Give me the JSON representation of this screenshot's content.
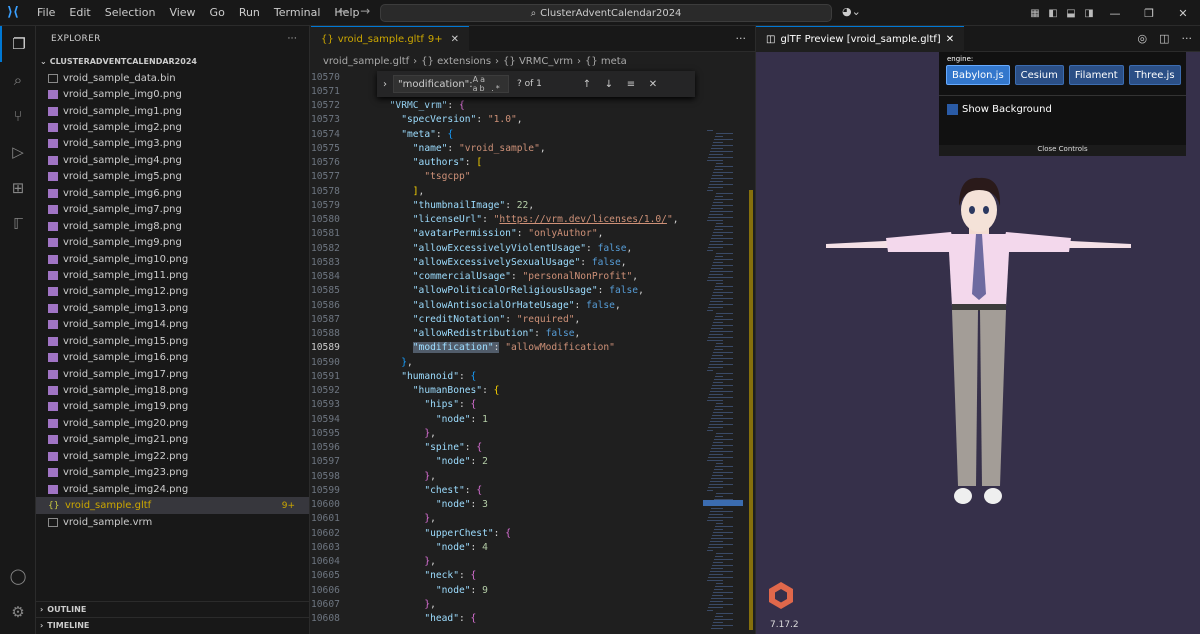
{
  "titlebar": {
    "menu": [
      "File",
      "Edit",
      "Selection",
      "View",
      "Go",
      "Run",
      "Terminal",
      "Help"
    ],
    "search": "ClusterAdventCalendar2024"
  },
  "sidebar": {
    "title": "EXPLORER",
    "root": "CLUSTERADVENTCALENDAR2024",
    "files": [
      {
        "name": "vroid_sample_data.bin",
        "type": "bin"
      },
      {
        "name": "vroid_sample_img0.png",
        "type": "png"
      },
      {
        "name": "vroid_sample_img1.png",
        "type": "png"
      },
      {
        "name": "vroid_sample_img2.png",
        "type": "png"
      },
      {
        "name": "vroid_sample_img3.png",
        "type": "png"
      },
      {
        "name": "vroid_sample_img4.png",
        "type": "png"
      },
      {
        "name": "vroid_sample_img5.png",
        "type": "png"
      },
      {
        "name": "vroid_sample_img6.png",
        "type": "png"
      },
      {
        "name": "vroid_sample_img7.png",
        "type": "png"
      },
      {
        "name": "vroid_sample_img8.png",
        "type": "png"
      },
      {
        "name": "vroid_sample_img9.png",
        "type": "png"
      },
      {
        "name": "vroid_sample_img10.png",
        "type": "png"
      },
      {
        "name": "vroid_sample_img11.png",
        "type": "png"
      },
      {
        "name": "vroid_sample_img12.png",
        "type": "png"
      },
      {
        "name": "vroid_sample_img13.png",
        "type": "png"
      },
      {
        "name": "vroid_sample_img14.png",
        "type": "png"
      },
      {
        "name": "vroid_sample_img15.png",
        "type": "png"
      },
      {
        "name": "vroid_sample_img16.png",
        "type": "png"
      },
      {
        "name": "vroid_sample_img17.png",
        "type": "png"
      },
      {
        "name": "vroid_sample_img18.png",
        "type": "png"
      },
      {
        "name": "vroid_sample_img19.png",
        "type": "png"
      },
      {
        "name": "vroid_sample_img20.png",
        "type": "png"
      },
      {
        "name": "vroid_sample_img21.png",
        "type": "png"
      },
      {
        "name": "vroid_sample_img22.png",
        "type": "png"
      },
      {
        "name": "vroid_sample_img23.png",
        "type": "png"
      },
      {
        "name": "vroid_sample_img24.png",
        "type": "png"
      },
      {
        "name": "vroid_sample.gltf",
        "type": "json",
        "badge": "9+",
        "selected": true
      },
      {
        "name": "vroid_sample.vrm",
        "type": "vrm"
      }
    ],
    "outline": "OUTLINE",
    "timeline": "TIMELINE"
  },
  "editor": {
    "tab_label": "vroid_sample.gltf",
    "tab_badge": "9+",
    "breadcrumbs": [
      "vroid_sample.gltf",
      "{} extensions",
      "{} VRMC_vrm",
      "{} meta"
    ],
    "find": {
      "query": "\"modification\":",
      "count": "? of 1",
      "options": "Aa ab .*"
    },
    "lines": [
      {
        "n": "10570",
        "t": [
          [
            "    ",
            "p"
          ],
          [
            "\"extensions\"",
            "k"
          ],
          [
            ": ",
            "p"
          ],
          [
            "{",
            "br1"
          ]
        ]
      },
      {
        "n": "10571",
        "t": [
          [
            "    ",
            "p"
          ],
          [
            "\"extensions\"",
            "k"
          ],
          [
            ": ",
            "p"
          ],
          [
            "{",
            "br1"
          ]
        ]
      },
      {
        "n": "10572",
        "t": [
          [
            "      ",
            "p"
          ],
          [
            "\"VRMC_vrm\"",
            "k"
          ],
          [
            ": ",
            "p"
          ],
          [
            "{",
            "br2"
          ]
        ]
      },
      {
        "n": "10573",
        "t": [
          [
            "        ",
            "p"
          ],
          [
            "\"specVersion\"",
            "k"
          ],
          [
            ": ",
            "p"
          ],
          [
            "\"1.0\"",
            "s"
          ],
          [
            ",",
            "p"
          ]
        ]
      },
      {
        "n": "10574",
        "t": [
          [
            "        ",
            "p"
          ],
          [
            "\"meta\"",
            "k"
          ],
          [
            ": ",
            "p"
          ],
          [
            "{",
            "br3"
          ]
        ]
      },
      {
        "n": "10575",
        "t": [
          [
            "          ",
            "p"
          ],
          [
            "\"name\"",
            "k"
          ],
          [
            ": ",
            "p"
          ],
          [
            "\"vroid_sample\"",
            "s"
          ],
          [
            ",",
            "p"
          ]
        ]
      },
      {
        "n": "10576",
        "t": [
          [
            "          ",
            "p"
          ],
          [
            "\"authors\"",
            "k"
          ],
          [
            ": ",
            "p"
          ],
          [
            "[",
            "br1"
          ]
        ]
      },
      {
        "n": "10577",
        "t": [
          [
            "            ",
            "p"
          ],
          [
            "\"tsgcpp\"",
            "s"
          ]
        ]
      },
      {
        "n": "10578",
        "t": [
          [
            "          ",
            "p"
          ],
          [
            "]",
            "br1"
          ],
          [
            ",",
            "p"
          ]
        ]
      },
      {
        "n": "10579",
        "t": [
          [
            "          ",
            "p"
          ],
          [
            "\"thumbnailImage\"",
            "k"
          ],
          [
            ": ",
            "p"
          ],
          [
            "22",
            "n"
          ],
          [
            ",",
            "p"
          ]
        ]
      },
      {
        "n": "10580",
        "t": [
          [
            "          ",
            "p"
          ],
          [
            "\"licenseUrl\"",
            "k"
          ],
          [
            ": ",
            "p"
          ],
          [
            "\"",
            "s"
          ],
          [
            "https://vrm.dev/licenses/1.0/",
            "s u"
          ],
          [
            "\"",
            "s"
          ],
          [
            ",",
            "p"
          ]
        ]
      },
      {
        "n": "10581",
        "t": [
          [
            "          ",
            "p"
          ],
          [
            "\"avatarPermission\"",
            "k"
          ],
          [
            ": ",
            "p"
          ],
          [
            "\"onlyAuthor\"",
            "s"
          ],
          [
            ",",
            "p"
          ]
        ]
      },
      {
        "n": "10582",
        "t": [
          [
            "          ",
            "p"
          ],
          [
            "\"allowExcessivelyViolentUsage\"",
            "k"
          ],
          [
            ": ",
            "p"
          ],
          [
            "false",
            "b"
          ],
          [
            ",",
            "p"
          ]
        ]
      },
      {
        "n": "10583",
        "t": [
          [
            "          ",
            "p"
          ],
          [
            "\"allowExcessivelySexualUsage\"",
            "k"
          ],
          [
            ": ",
            "p"
          ],
          [
            "false",
            "b"
          ],
          [
            ",",
            "p"
          ]
        ]
      },
      {
        "n": "10584",
        "t": [
          [
            "          ",
            "p"
          ],
          [
            "\"commercialUsage\"",
            "k"
          ],
          [
            ": ",
            "p"
          ],
          [
            "\"personalNonProfit\"",
            "s"
          ],
          [
            ",",
            "p"
          ]
        ]
      },
      {
        "n": "10585",
        "t": [
          [
            "          ",
            "p"
          ],
          [
            "\"allowPoliticalOrReligiousUsage\"",
            "k"
          ],
          [
            ": ",
            "p"
          ],
          [
            "false",
            "b"
          ],
          [
            ",",
            "p"
          ]
        ]
      },
      {
        "n": "10586",
        "t": [
          [
            "          ",
            "p"
          ],
          [
            "\"allowAntisocialOrHateUsage\"",
            "k"
          ],
          [
            ": ",
            "p"
          ],
          [
            "false",
            "b"
          ],
          [
            ",",
            "p"
          ]
        ]
      },
      {
        "n": "10587",
        "t": [
          [
            "          ",
            "p"
          ],
          [
            "\"creditNotation\"",
            "k"
          ],
          [
            ": ",
            "p"
          ],
          [
            "\"required\"",
            "s"
          ],
          [
            ",",
            "p"
          ]
        ]
      },
      {
        "n": "10588",
        "t": [
          [
            "          ",
            "p"
          ],
          [
            "\"allowRedistribution\"",
            "k"
          ],
          [
            ": ",
            "p"
          ],
          [
            "false",
            "b"
          ],
          [
            ",",
            "p"
          ]
        ]
      },
      {
        "n": "10589",
        "cur": true,
        "t": [
          [
            "          ",
            "p"
          ],
          [
            "\"modification\"",
            "k hl"
          ],
          [
            ":",
            "p hl"
          ],
          [
            " ",
            "p"
          ],
          [
            "\"allowModification\"",
            "s"
          ]
        ]
      },
      {
        "n": "10590",
        "t": [
          [
            "        ",
            "p"
          ],
          [
            "}",
            "br3"
          ],
          [
            ",",
            "p"
          ]
        ]
      },
      {
        "n": "10591",
        "t": [
          [
            "        ",
            "p"
          ],
          [
            "\"humanoid\"",
            "k"
          ],
          [
            ": ",
            "p"
          ],
          [
            "{",
            "br3"
          ]
        ]
      },
      {
        "n": "10592",
        "t": [
          [
            "          ",
            "p"
          ],
          [
            "\"humanBones\"",
            "k"
          ],
          [
            ": ",
            "p"
          ],
          [
            "{",
            "br1"
          ]
        ]
      },
      {
        "n": "10593",
        "t": [
          [
            "            ",
            "p"
          ],
          [
            "\"hips\"",
            "k"
          ],
          [
            ": ",
            "p"
          ],
          [
            "{",
            "br2"
          ]
        ]
      },
      {
        "n": "10594",
        "t": [
          [
            "              ",
            "p"
          ],
          [
            "\"node\"",
            "k"
          ],
          [
            ": ",
            "p"
          ],
          [
            "1",
            "n"
          ]
        ]
      },
      {
        "n": "10595",
        "t": [
          [
            "            ",
            "p"
          ],
          [
            "}",
            "br2"
          ],
          [
            ",",
            "p"
          ]
        ]
      },
      {
        "n": "10596",
        "t": [
          [
            "            ",
            "p"
          ],
          [
            "\"spine\"",
            "k"
          ],
          [
            ": ",
            "p"
          ],
          [
            "{",
            "br2"
          ]
        ]
      },
      {
        "n": "10597",
        "t": [
          [
            "              ",
            "p"
          ],
          [
            "\"node\"",
            "k"
          ],
          [
            ": ",
            "p"
          ],
          [
            "2",
            "n"
          ]
        ]
      },
      {
        "n": "10598",
        "t": [
          [
            "            ",
            "p"
          ],
          [
            "}",
            "br2"
          ],
          [
            ",",
            "p"
          ]
        ]
      },
      {
        "n": "10599",
        "t": [
          [
            "            ",
            "p"
          ],
          [
            "\"chest\"",
            "k"
          ],
          [
            ": ",
            "p"
          ],
          [
            "{",
            "br2"
          ]
        ]
      },
      {
        "n": "10600",
        "t": [
          [
            "              ",
            "p"
          ],
          [
            "\"node\"",
            "k"
          ],
          [
            ": ",
            "p"
          ],
          [
            "3",
            "n"
          ]
        ]
      },
      {
        "n": "10601",
        "t": [
          [
            "            ",
            "p"
          ],
          [
            "}",
            "br2"
          ],
          [
            ",",
            "p"
          ]
        ]
      },
      {
        "n": "10602",
        "t": [
          [
            "            ",
            "p"
          ],
          [
            "\"upperChest\"",
            "k"
          ],
          [
            ": ",
            "p"
          ],
          [
            "{",
            "br2"
          ]
        ]
      },
      {
        "n": "10603",
        "t": [
          [
            "              ",
            "p"
          ],
          [
            "\"node\"",
            "k"
          ],
          [
            ": ",
            "p"
          ],
          [
            "4",
            "n"
          ]
        ]
      },
      {
        "n": "10604",
        "t": [
          [
            "            ",
            "p"
          ],
          [
            "}",
            "br2"
          ],
          [
            ",",
            "p"
          ]
        ]
      },
      {
        "n": "10605",
        "t": [
          [
            "            ",
            "p"
          ],
          [
            "\"neck\"",
            "k"
          ],
          [
            ": ",
            "p"
          ],
          [
            "{",
            "br2"
          ]
        ]
      },
      {
        "n": "10606",
        "t": [
          [
            "              ",
            "p"
          ],
          [
            "\"node\"",
            "k"
          ],
          [
            ": ",
            "p"
          ],
          [
            "9",
            "n"
          ]
        ]
      },
      {
        "n": "10607",
        "t": [
          [
            "            ",
            "p"
          ],
          [
            "}",
            "br2"
          ],
          [
            ",",
            "p"
          ]
        ]
      },
      {
        "n": "10608",
        "t": [
          [
            "            ",
            "p"
          ],
          [
            "\"head\"",
            "k"
          ],
          [
            ": ",
            "p"
          ],
          [
            "{",
            "br2"
          ]
        ]
      }
    ]
  },
  "preview": {
    "tab_label": "glTF Preview [vroid_sample.gltf]",
    "engine_label": "engine:",
    "engines": [
      {
        "label": "Babylon.js",
        "active": true
      },
      {
        "label": "Cesium",
        "active": false
      },
      {
        "label": "Filament",
        "active": false
      },
      {
        "label": "Three.js",
        "active": false
      }
    ],
    "show_background": "Show Background",
    "close_controls": "Close Controls",
    "version": "7.17.2"
  }
}
